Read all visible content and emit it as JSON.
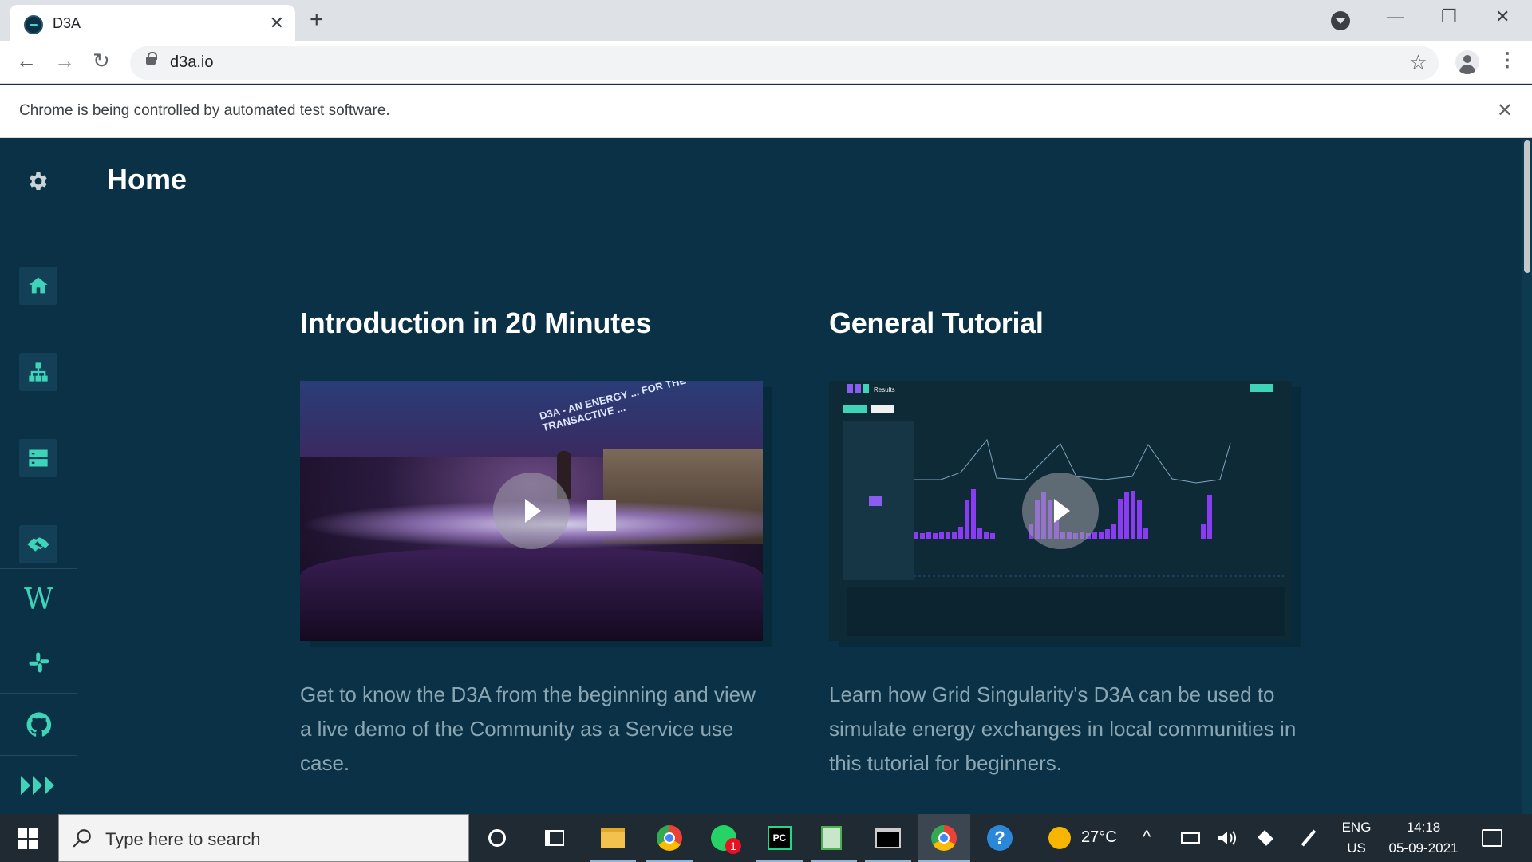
{
  "browser": {
    "tab_title": "D3A",
    "tab_close": "✕",
    "new_tab": "+",
    "url": "d3a.io",
    "infobar_text": "Chrome is being controlled by automated test software.",
    "infobar_close": "✕",
    "controls": {
      "minimize": "—",
      "restore": "❐",
      "close": "✕"
    },
    "nav": {
      "back": "←",
      "forward": "→",
      "reload": "↻",
      "star": "☆",
      "menu": "⋮"
    }
  },
  "app": {
    "page_title": "Home",
    "sidebar": {
      "settings_icon": "gear-icon",
      "items": [
        {
          "name": "home",
          "icon": "home-icon",
          "active": true
        },
        {
          "name": "collaborations",
          "icon": "hierarchy-icon"
        },
        {
          "name": "projects",
          "icon": "database-icon"
        },
        {
          "name": "markets",
          "icon": "handshake-icon"
        },
        {
          "name": "wiki",
          "icon": "wikipedia-icon",
          "label": "W"
        },
        {
          "name": "slack",
          "icon": "slack-icon"
        },
        {
          "name": "github",
          "icon": "github-icon"
        },
        {
          "name": "logo",
          "icon": "gsy-logo-icon"
        }
      ]
    },
    "cards": [
      {
        "title": "Introduction in 20 Minutes",
        "description": "Get to know the D3A from the beginning and view a live demo of the Community as a Service use case.",
        "banner_text": "D3A - AN ENERGY ... FOR THE TRANSACTIVE ..."
      },
      {
        "title": "General Tutorial",
        "description": "Learn how Grid Singularity's D3A can be used to simulate energy exchanges in local communities in this tutorial for beginners.",
        "screen_title": "Results"
      }
    ],
    "accent_color": "#3fd3b9",
    "background_color": "#0a3145"
  },
  "taskbar": {
    "search_placeholder": "Type here to search",
    "weather_temp": "27°C",
    "language": "ENG",
    "region": "US",
    "time": "14:18",
    "date": "05-09-2021",
    "whatsapp_badge": "1",
    "apps": [
      "cortana-icon",
      "task-view-icon",
      "file-explorer-icon",
      "chrome-icon",
      "whatsapp-icon",
      "pycharm-icon",
      "notepad-icon",
      "terminal-icon",
      "chrome-active-icon",
      "help-icon"
    ]
  }
}
